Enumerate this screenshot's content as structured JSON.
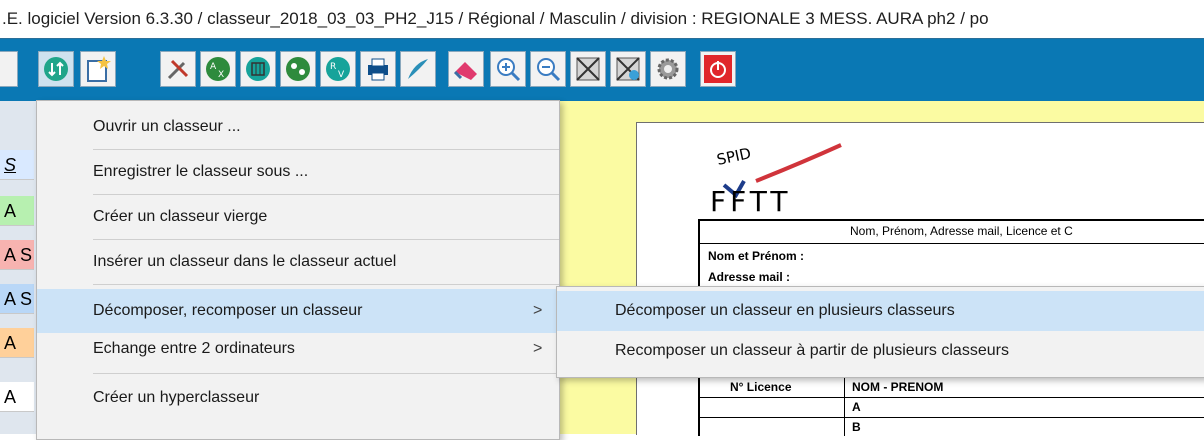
{
  "title": ".E. logiciel Version 6.3.30 / classeur_2018_03_03_PH2_J15 / Régional / Masculin / division : REGIONALE 3 MESS. AURA ph2 / po",
  "toolbar": {
    "icons": [
      "sort-icon",
      "new-sheet-icon",
      "tools-icon",
      "ax-icon",
      "grid-icon",
      "team-icon",
      "rv-icon",
      "print-icon",
      "quill-icon",
      "eraser-icon",
      "zoom-in-icon",
      "zoom-out-icon",
      "cross-grid-icon",
      "grid-refresh-icon",
      "gear-icon",
      "power-icon"
    ]
  },
  "left_cells": [
    {
      "text": "S",
      "color": "#d9e9ff"
    },
    {
      "text": "A",
      "color": "#b7f0b0"
    },
    {
      "text": "A S",
      "color": "#f7b3b0"
    },
    {
      "text": "A S",
      "color": "#b9d7f7"
    },
    {
      "text": "A",
      "color": "#ffd09a"
    },
    {
      "text": "A",
      "color": "#ffffff"
    }
  ],
  "menu": {
    "items": [
      {
        "label": "Ouvrir un classeur ..."
      },
      {
        "label": "Enregistrer le classeur sous ..."
      },
      {
        "label": "Créer un classeur vierge"
      },
      {
        "label": "Insérer un classeur dans le classeur actuel"
      },
      {
        "label": "Décomposer, recomposer un classeur",
        "arrow": ">"
      },
      {
        "label": "Echange entre 2 ordinateurs",
        "arrow": ">"
      },
      {
        "label": "Créer un hyperclasseur"
      }
    ]
  },
  "submenu": {
    "items": [
      {
        "label": "Décomposer un classeur en plusieurs classeurs"
      },
      {
        "label": "Recomposer un classeur à partir de plusieurs classeurs"
      }
    ]
  },
  "document": {
    "logo_top": "SPID",
    "logo_bottom": "FFTT",
    "header": "Nom, Prénom, Adresse mail, Licence et C",
    "name_label": "Nom et Prénom :",
    "email_label": "Adresse mail  :",
    "col_licence": "N° Licence",
    "col_name": "NOM - PRENOM",
    "row_a": "A",
    "row_b": "B"
  },
  "colors": {
    "toolbar": "#0a78b4",
    "yellow": "#fbfba2",
    "highlight": "#cce3f7"
  }
}
